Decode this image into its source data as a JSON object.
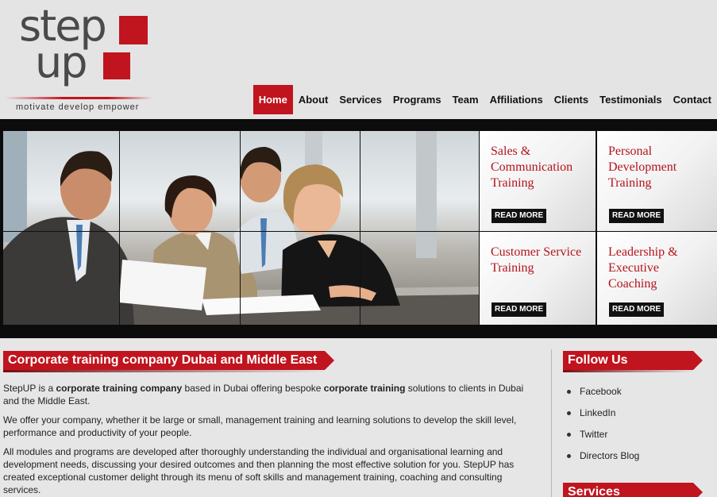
{
  "brand": {
    "logo_top": "step",
    "logo_bottom": "up",
    "tagline": "motivate   develop   empower",
    "accent": "#c0141e"
  },
  "nav": {
    "items": [
      {
        "label": "Home",
        "active": true
      },
      {
        "label": "About"
      },
      {
        "label": "Services"
      },
      {
        "label": "Programs"
      },
      {
        "label": "Team"
      },
      {
        "label": "Affiliations"
      },
      {
        "label": "Clients"
      },
      {
        "label": "Testimonials"
      },
      {
        "label": "Contact"
      }
    ]
  },
  "tiles": [
    {
      "title": "Sales & Communication Training",
      "cta": "READ MORE"
    },
    {
      "title": "Personal Development Training",
      "cta": "READ MORE"
    },
    {
      "title": "Customer Service Training",
      "cta": "READ MORE"
    },
    {
      "title": "Leadership & Executive Coaching",
      "cta": "READ MORE"
    }
  ],
  "main": {
    "heading": "Corporate training company Dubai and Middle East",
    "p1": {
      "a": "StepUP is a ",
      "b": "corporate training company",
      "c": " based in Dubai offering bespoke ",
      "d": "corporate training",
      "e": " solutions to clients in Dubai and the Middle East."
    },
    "p2": "We offer your company, whether it be large or small, management training and learning solutions to develop the skill level, performance and productivity of your people.",
    "p3": "All modules and programs are developed after thoroughly understanding the individual and organisational learning and development needs, discussing your desired outcomes and then planning the most effective solution for you. StepUP has created exceptional customer delight through its menu of soft skills and management training, coaching and consulting services."
  },
  "sidebar": {
    "follow_heading": "Follow Us",
    "links": [
      "Facebook",
      "LinkedIn",
      "Twitter",
      "Directors Blog"
    ],
    "services_heading": "Services"
  }
}
